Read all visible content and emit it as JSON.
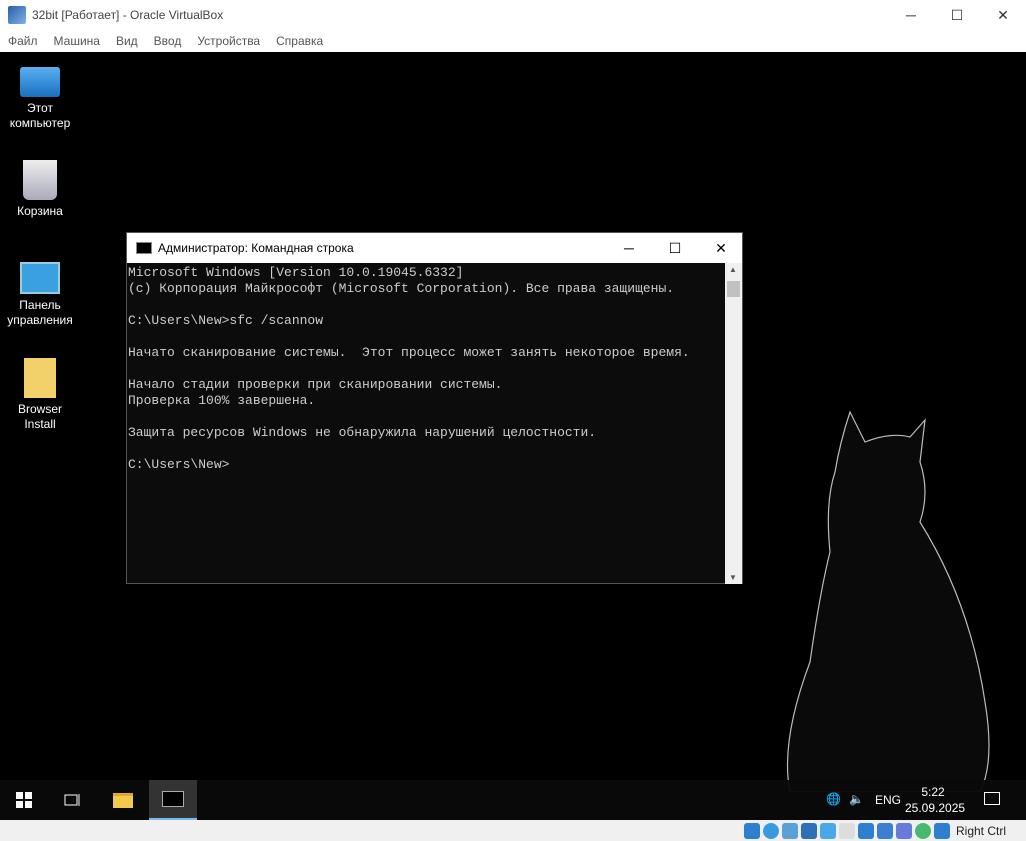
{
  "window": {
    "title": "32bit [Работает] - Oracle VirtualBox",
    "minimize": "─",
    "maximize": "☐",
    "close": "✕"
  },
  "menu": [
    "Файл",
    "Машина",
    "Вид",
    "Ввод",
    "Устройства",
    "Справка"
  ],
  "desktop": [
    {
      "line1": "Этот",
      "line2": "компьютер"
    },
    {
      "line1": "Корзина",
      "line2": ""
    },
    {
      "line1": "Панель",
      "line2": "управления"
    },
    {
      "line1": "Browser",
      "line2": "Install"
    }
  ],
  "cmd": {
    "title": "Администратор: Командная строка",
    "lines": [
      "Microsoft Windows [Version 10.0.19045.6332]",
      "(c) Корпорация Майкрософт (Microsoft Corporation). Все права защищены.",
      "",
      "C:\\Users\\New>sfc /scannow",
      "",
      "Начато сканирование системы.  Этот процесс может занять некоторое время.",
      "",
      "Начало стадии проверки при сканировании системы.",
      "Проверка 100% завершена.",
      "",
      "Защита ресурсов Windows не обнаружила нарушений целостности.",
      "",
      "C:\\Users\\New>"
    ]
  },
  "tray": {
    "lang": "ENG",
    "time": "5:22",
    "date": "25.09.2025"
  },
  "status": {
    "hostkey": "Right Ctrl"
  }
}
